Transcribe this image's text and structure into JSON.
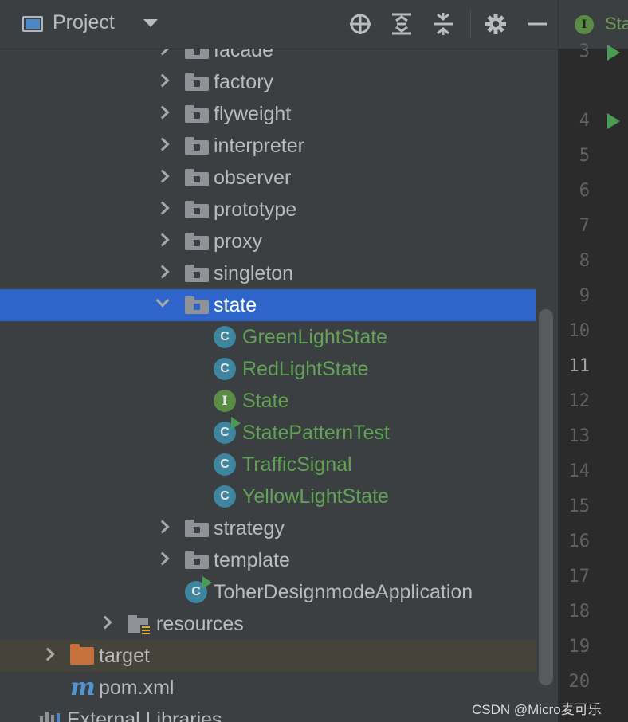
{
  "header": {
    "title": "Project",
    "icons": [
      "window-icon",
      "locate-icon",
      "expand-all-icon",
      "collapse-all-icon",
      "gear-icon",
      "minimize-icon"
    ]
  },
  "editor": {
    "tab_label": "Sta",
    "tab_icon_letter": "I",
    "line_numbers": [
      "3",
      "4",
      "5",
      "6",
      "7",
      "8",
      "9",
      "10",
      "11",
      "12",
      "13",
      "14",
      "15",
      "16",
      "17",
      "18",
      "19",
      "20"
    ],
    "current_line": "11"
  },
  "tree": {
    "items": [
      {
        "label": "facade",
        "type": "package",
        "expanded": false
      },
      {
        "label": "factory",
        "type": "package",
        "expanded": false
      },
      {
        "label": "flyweight",
        "type": "package",
        "expanded": false
      },
      {
        "label": "interpreter",
        "type": "package",
        "expanded": false
      },
      {
        "label": "observer",
        "type": "package",
        "expanded": false
      },
      {
        "label": "prototype",
        "type": "package",
        "expanded": false
      },
      {
        "label": "proxy",
        "type": "package",
        "expanded": false
      },
      {
        "label": "singleton",
        "type": "package",
        "expanded": false
      },
      {
        "label": "state",
        "type": "package",
        "expanded": true,
        "selected": true
      },
      {
        "label": "GreenLightState",
        "type": "class"
      },
      {
        "label": "RedLightState",
        "type": "class"
      },
      {
        "label": "State",
        "type": "interface"
      },
      {
        "label": "StatePatternTest",
        "type": "runnable-class"
      },
      {
        "label": "TrafficSignal",
        "type": "class"
      },
      {
        "label": "YellowLightState",
        "type": "class"
      },
      {
        "label": "strategy",
        "type": "package",
        "expanded": false
      },
      {
        "label": "template",
        "type": "package",
        "expanded": false
      },
      {
        "label": "ToherDesignmodeApplication",
        "type": "spring-app"
      },
      {
        "label": "resources",
        "type": "resources-folder",
        "expanded": false
      },
      {
        "label": "target",
        "type": "excluded-folder",
        "expanded": false
      },
      {
        "label": "pom.xml",
        "type": "maven-file"
      },
      {
        "label": "External Libraries",
        "type": "libraries"
      }
    ],
    "class_icon_letter": "C",
    "interface_icon_letter": "I",
    "maven_icon_letter": "m"
  },
  "watermark": "CSDN @Micro麦可乐",
  "colors": {
    "selection": "#2f65ca",
    "class_name": "#62a257",
    "class_icon": "#3e86a0",
    "interface_icon": "#5b8c45",
    "target_folder": "#c6703e"
  }
}
